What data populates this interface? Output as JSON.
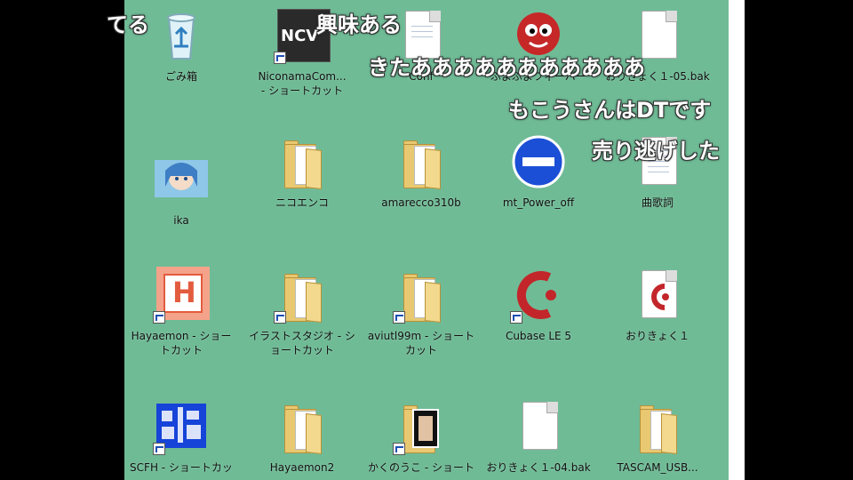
{
  "desktop": {
    "icons": [
      {
        "label": "ごみ箱"
      },
      {
        "label": "NiconamaCom...\n- ショートカット",
        "badge": "NCV"
      },
      {
        "label": "Conf"
      },
      {
        "label": "ぷよぷよフィーバー"
      },
      {
        "label": "おりきょく１-05.bak"
      },
      {
        "label": "ika"
      },
      {
        "label": "ニコエンコ"
      },
      {
        "label": "amarecco310b"
      },
      {
        "label": "mt_Power_off"
      },
      {
        "label": "曲歌詞"
      },
      {
        "label": "Hayaemon - ショートカット",
        "glyph": "H"
      },
      {
        "label": "イラストスタジオ - ショートカット"
      },
      {
        "label": "aviutl99m - ショートカット"
      },
      {
        "label": "Cubase LE 5"
      },
      {
        "label": "おりきょく１"
      },
      {
        "label": "SCFH - ショートカッ"
      },
      {
        "label": "Hayaemon2"
      },
      {
        "label": "かくのうこ - ショート"
      },
      {
        "label": "おりきょく１-04.bak"
      },
      {
        "label": "TASCAM_USB..."
      }
    ]
  },
  "comments": [
    {
      "text": "てる"
    },
    {
      "text": "興味ある"
    },
    {
      "text": "きたあああああああああああ"
    },
    {
      "text": "もこうさんはDTです"
    },
    {
      "text": "売り逃げした"
    }
  ],
  "colors": {
    "desktop_bg": "#6fbb96",
    "comment_text": "#ffffff"
  }
}
